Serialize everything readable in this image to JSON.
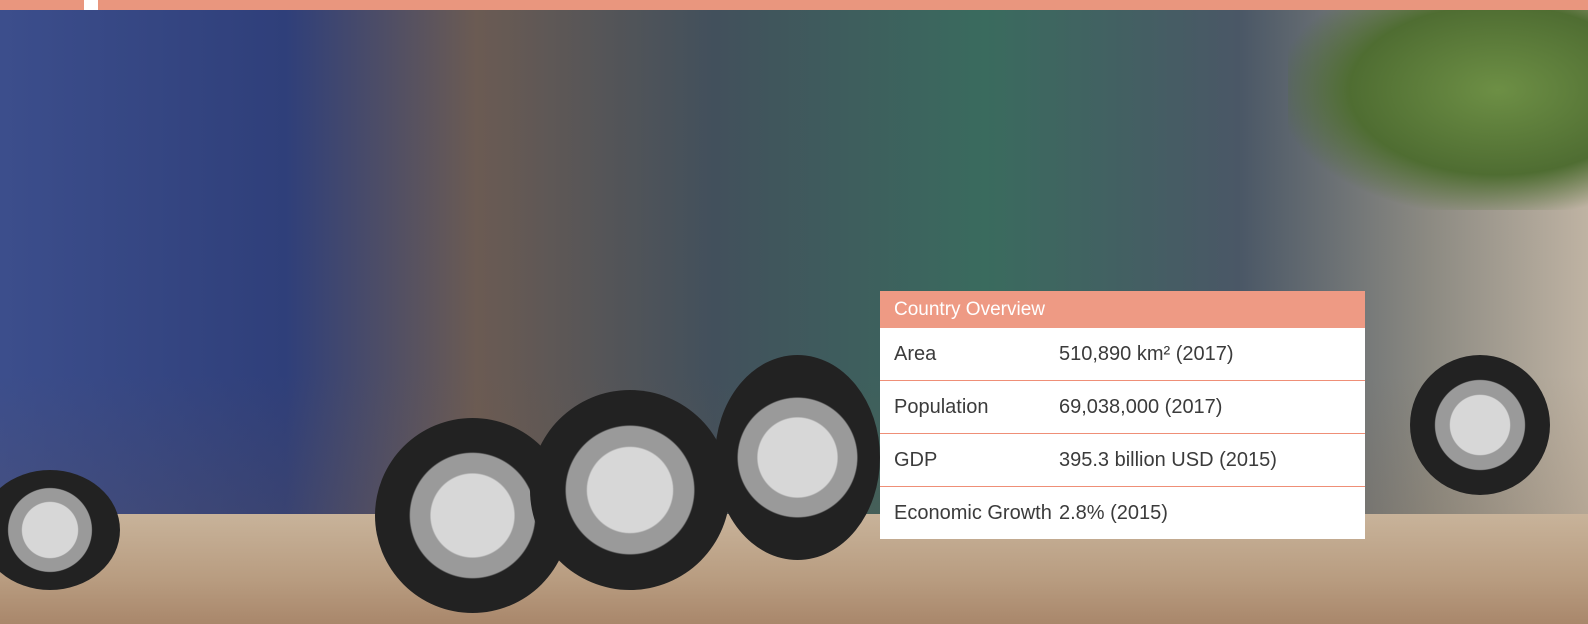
{
  "image": {
    "alt": "Row of parked tuk-tuks and motorbikes"
  },
  "overview": {
    "title": "Country Overview",
    "rows": [
      {
        "label": "Area",
        "value": "510,890 km² (2017)"
      },
      {
        "label": "Population",
        "value": "69,038,000 (2017)"
      },
      {
        "label": "GDP",
        "value": "395.3 billion USD (2015)"
      },
      {
        "label": "Economic Growth",
        "value": "2.8% (2015)"
      }
    ]
  },
  "colors": {
    "accent": "#ee9a84",
    "divider": "#ef8f77",
    "text": "#3b3b3b"
  }
}
